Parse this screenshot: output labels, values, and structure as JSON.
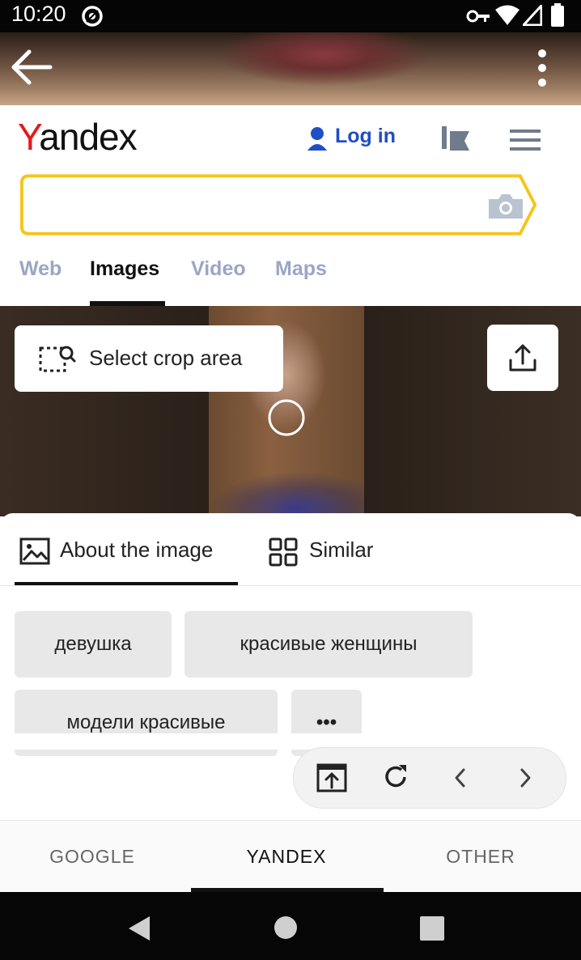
{
  "status_bar": {
    "time": "10:20"
  },
  "header": {
    "logo_first": "Y",
    "logo_rest": "andex",
    "login_label": "Log in"
  },
  "search": {
    "value": "",
    "placeholder": ""
  },
  "tabs": [
    {
      "label": "Web",
      "active": false
    },
    {
      "label": "Images",
      "active": true
    },
    {
      "label": "Video",
      "active": false
    },
    {
      "label": "Maps",
      "active": false
    }
  ],
  "image_viewer": {
    "crop_label": "Select crop area"
  },
  "sheet": {
    "tab_about": "About the image",
    "tab_similar": "Similar",
    "chips": [
      "девушка",
      "красивые женщины",
      "модели красивые",
      "•••"
    ]
  },
  "engines": [
    {
      "label": "GOOGLE",
      "active": false
    },
    {
      "label": "YANDEX",
      "active": true
    },
    {
      "label": "OTHER",
      "active": false
    }
  ],
  "colors": {
    "yandex_red": "#e41a1a",
    "search_border": "#f5c518",
    "link_blue": "#1f4fc6",
    "tab_inactive": "#9aa6c4"
  }
}
